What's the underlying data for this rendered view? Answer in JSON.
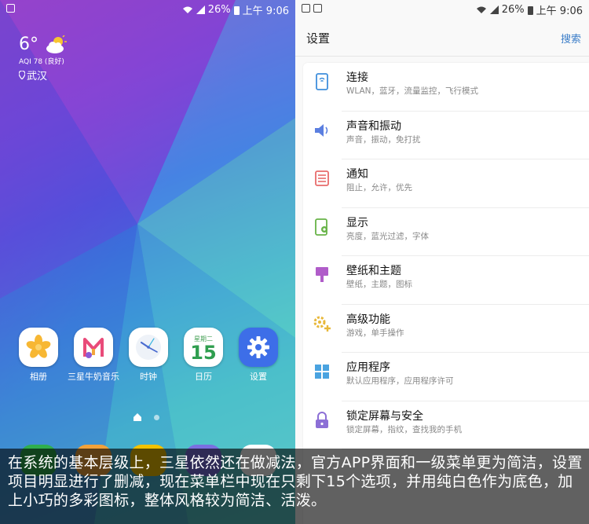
{
  "home": {
    "status": {
      "battery": "26%",
      "time": "上午 9:06"
    },
    "weather": {
      "temp": "6°",
      "aqi": "AQI 78 (良好)",
      "city": "武汉"
    },
    "apps": [
      {
        "label": "相册",
        "icon": "gallery-icon"
      },
      {
        "label": "三星牛奶音乐",
        "icon": "music-icon"
      },
      {
        "label": "时钟",
        "icon": "clock-icon"
      },
      {
        "label": "日历",
        "icon": "calendar-icon",
        "weekday": "星期二",
        "day": "15"
      },
      {
        "label": "设置",
        "icon": "settings-gear-icon"
      }
    ],
    "dock_colors": [
      "#2fae4e",
      "#f2a23a",
      "#f2c200",
      "#7a6fe0",
      "#ffffff"
    ]
  },
  "settings": {
    "status": {
      "battery": "26%",
      "time": "上午 9:06"
    },
    "title": "设置",
    "search_label": "搜索",
    "items": [
      {
        "title": "连接",
        "sub": "WLAN，蓝牙，流量监控，飞行模式",
        "icon": "connections-icon",
        "color": "#3f8fdc"
      },
      {
        "title": "声音和振动",
        "sub": "声音，振动，免打扰",
        "icon": "speaker-icon",
        "color": "#5b7fe0"
      },
      {
        "title": "通知",
        "sub": "阻止，允许，优先",
        "icon": "notification-icon",
        "color": "#e86b6b"
      },
      {
        "title": "显示",
        "sub": "亮度，蓝光过滤，字体",
        "icon": "display-icon",
        "color": "#67b347"
      },
      {
        "title": "壁纸和主题",
        "sub": "壁纸，主题，图标",
        "icon": "wallpaper-icon",
        "color": "#b05cc9"
      },
      {
        "title": "高级功能",
        "sub": "游戏，单手操作",
        "icon": "advanced-features-icon",
        "color": "#e8b83a"
      },
      {
        "title": "应用程序",
        "sub": "默认应用程序，应用程序许可",
        "icon": "apps-grid-icon",
        "color": "#4aa3e0"
      },
      {
        "title": "锁定屏幕与安全",
        "sub": "锁定屏幕，指纹，查找我的手机",
        "icon": "lock-icon",
        "color": "#8c6fd6"
      }
    ]
  },
  "caption": {
    "text": "在系统的基本层级上，三星依然还在做减法，官方APP界面和一级菜单更为简洁，设置项目明显进行了删减，现在菜单栏中现在只剩下15个选项，并用纯白色作为底色，加上小巧的多彩图标，整体风格较为简洁、活泼。"
  }
}
